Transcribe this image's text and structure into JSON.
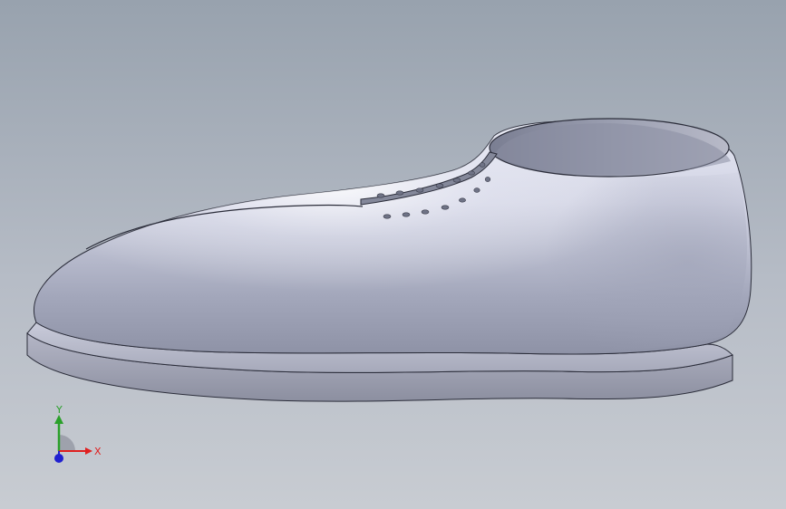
{
  "viewport": {
    "background_top": "#98a2ae",
    "background_bottom": "#c8ccd2",
    "model": "shoe-model"
  },
  "triad": {
    "x_label": "X",
    "y_label": "Y",
    "x_color": "#e02020",
    "y_color": "#2aa02a",
    "z_color": "#2020d0"
  }
}
